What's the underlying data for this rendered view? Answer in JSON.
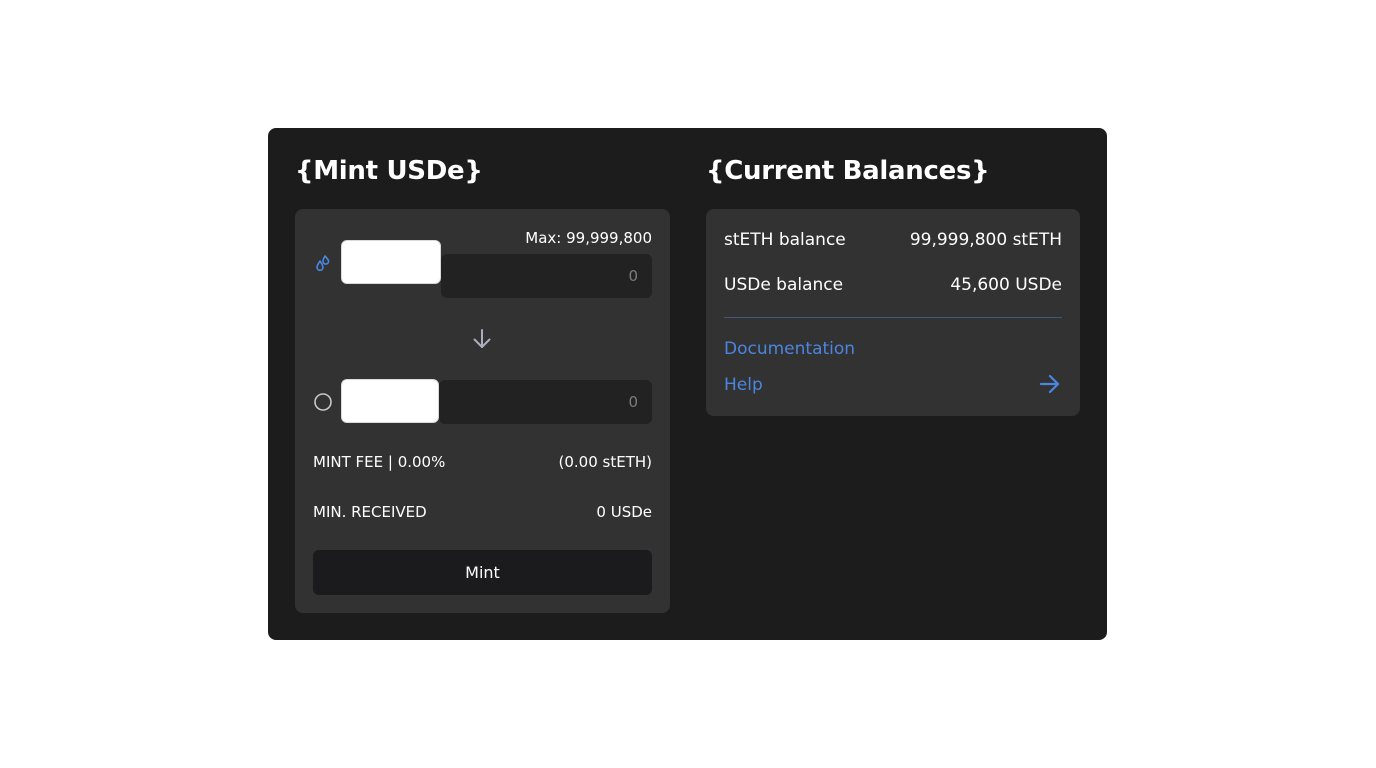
{
  "colors": {
    "accent": "#4a86e0",
    "card_bg": "#1c1c1c",
    "panel_bg": "#323232",
    "input_bg": "#222222",
    "button_bg": "#1b1b1d"
  },
  "mint": {
    "title": "{Mint USDe}",
    "max_label": "Max: 99,999,800",
    "from": {
      "icon": "drops-icon",
      "value": "",
      "placeholder": "0"
    },
    "to": {
      "icon": "circle-icon",
      "value": "",
      "placeholder": "0"
    },
    "fee_label": "MINT FEE | 0.00%",
    "fee_value": "(0.00 stETH)",
    "min_received_label": "MIN. RECEIVED",
    "min_received_value": "0 USDe",
    "button_label": "Mint"
  },
  "balances": {
    "title": "{Current Balances}",
    "rows": [
      {
        "label": "stETH balance",
        "value": "99,999,800 stETH"
      },
      {
        "label": "USDe balance",
        "value": "45,600 USDe"
      }
    ],
    "links": [
      {
        "label": "Documentation"
      },
      {
        "label": "Help",
        "icon": "arrow-right-icon"
      }
    ]
  }
}
